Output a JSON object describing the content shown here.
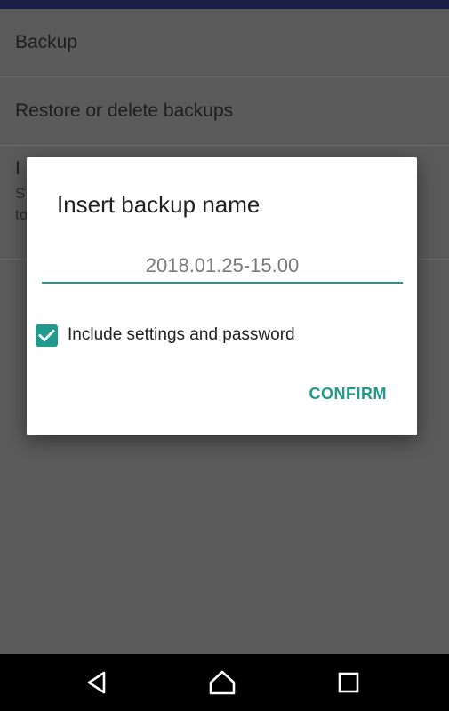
{
  "list": {
    "items": [
      {
        "title": "Backup"
      },
      {
        "title": "Restore or delete backups"
      },
      {
        "title": "I",
        "subtitle_line1": "S",
        "subtitle_line2": "to"
      }
    ]
  },
  "dialog": {
    "title": "Insert backup name",
    "name_input": {
      "value": "2018.01.25-15.00",
      "placeholder": "2018.01.25-15.00"
    },
    "checkbox": {
      "label": "Include settings and password",
      "checked": true
    },
    "confirm_label": "CONFIRM"
  },
  "nav": {
    "back_icon": "back-triangle-icon",
    "home_icon": "home-icon",
    "recents_icon": "recents-square-icon"
  },
  "colors": {
    "accent": "#1f9a8c",
    "scrim": "#5b5b5b",
    "navbar": "#000000"
  }
}
